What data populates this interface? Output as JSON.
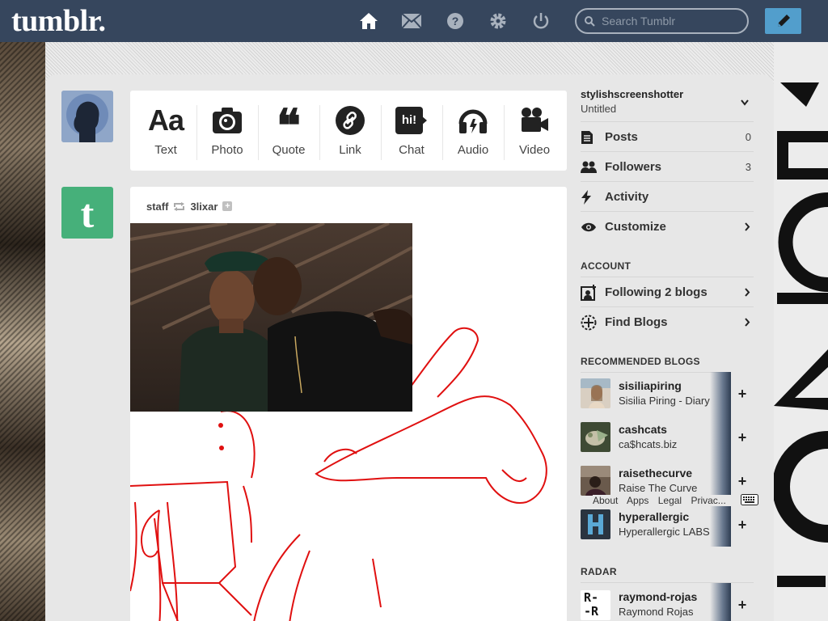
{
  "topbar": {
    "logo": "tumblr.",
    "search_placeholder": "Search Tumblr",
    "nav": [
      "home-icon",
      "mail-icon",
      "help-icon",
      "gear-icon",
      "power-icon"
    ]
  },
  "post_types": [
    {
      "label": "Text",
      "icon": "text-icon"
    },
    {
      "label": "Photo",
      "icon": "camera-icon"
    },
    {
      "label": "Quote",
      "icon": "quote-icon"
    },
    {
      "label": "Link",
      "icon": "link-icon"
    },
    {
      "label": "Chat",
      "icon": "chat-icon"
    },
    {
      "label": "Audio",
      "icon": "audio-icon"
    },
    {
      "label": "Video",
      "icon": "video-icon"
    }
  ],
  "text_glyph": "Aa",
  "quote_glyph": "❝",
  "chat_glyph": "hi!",
  "post": {
    "author": "staff",
    "reblogged_from": "3lixar"
  },
  "sidebar": {
    "blog_name": "stylishscreenshotter",
    "blog_title": "Untitled",
    "stats": [
      {
        "label": "Posts",
        "count": "0"
      },
      {
        "label": "Followers",
        "count": "3"
      },
      {
        "label": "Activity"
      },
      {
        "label": "Customize"
      }
    ],
    "account_heading": "ACCOUNT",
    "account": [
      {
        "label": "Following 2 blogs"
      },
      {
        "label": "Find Blogs"
      }
    ],
    "recommended_heading": "RECOMMENDED BLOGS",
    "recommended": [
      {
        "name": "sisiliapiring",
        "subtitle": "Sisilia Piring - Diary"
      },
      {
        "name": "cashcats",
        "subtitle": "ca$hcats.biz"
      },
      {
        "name": "raisethecurve",
        "subtitle": "Raise The Curve"
      },
      {
        "name": "hyperallergic",
        "subtitle": "Hyperallergic LABS"
      }
    ],
    "follow_glyph": "+",
    "footer": [
      "About",
      "Apps",
      "Legal",
      "Privac..."
    ],
    "radar_heading": "RADAR",
    "radar": [
      {
        "name": "raymond-rojas",
        "subtitle": "Raymond Rojas"
      }
    ],
    "radar_avatar_text": [
      "R-",
      "-R"
    ]
  },
  "colors": {
    "navbar": "#36465d",
    "compose": "#529ecc",
    "staff_avatar": "#46b07a",
    "sketch_line": "#e01010"
  }
}
